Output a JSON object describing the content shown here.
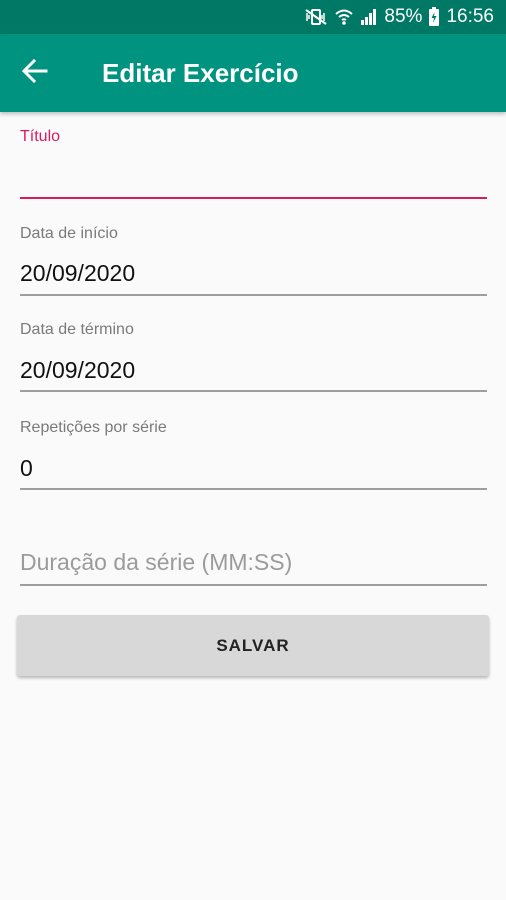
{
  "status_bar": {
    "battery": "85%",
    "time": "16:56",
    "icons": [
      "mute-vibrate-icon",
      "wifi-icon",
      "signal-icon",
      "battery-icon"
    ]
  },
  "app_bar": {
    "title": "Editar Exercício",
    "back_icon": "arrow-back-icon",
    "color": "#009380"
  },
  "form": {
    "titulo": {
      "label": "Título",
      "value": ""
    },
    "data_inicio": {
      "label": "Data de início",
      "value": "20/09/2020"
    },
    "data_termino": {
      "label": "Data de término",
      "value": "20/09/2020"
    },
    "repeticoes": {
      "label": "Repetições por série",
      "value": "0"
    },
    "duracao": {
      "placeholder": "Duração da série (MM:SS)",
      "value": ""
    }
  },
  "actions": {
    "save_label": "SALVAR"
  },
  "colors": {
    "accent": "#d81b60",
    "primary": "#009380",
    "primary_dark": "#007866"
  }
}
